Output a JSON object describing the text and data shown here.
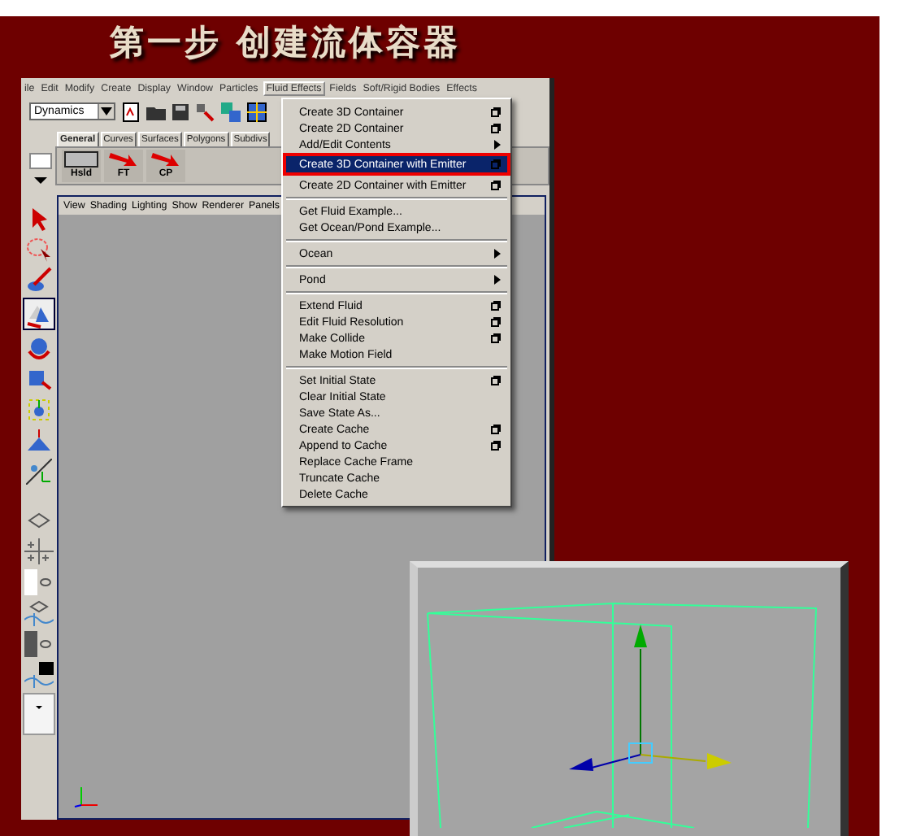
{
  "title": "第一步 创建流体容器",
  "menu_bar": [
    {
      "label": "ile",
      "selected": false
    },
    {
      "label": "Edit",
      "selected": false
    },
    {
      "label": "Modify",
      "selected": false
    },
    {
      "label": "Create",
      "selected": false
    },
    {
      "label": "Display",
      "selected": false
    },
    {
      "label": "Window",
      "selected": false
    },
    {
      "label": "Particles",
      "selected": false
    },
    {
      "label": "Fluid Effects",
      "selected": true
    },
    {
      "label": "Fields",
      "selected": false
    },
    {
      "label": "Soft/Rigid Bodies",
      "selected": false
    },
    {
      "label": "Effects",
      "selected": false
    }
  ],
  "mode_dropdown": {
    "value": "Dynamics"
  },
  "shelf_tabs": [
    {
      "label": "General",
      "selected": true
    },
    {
      "label": "Curves",
      "selected": false
    },
    {
      "label": "Surfaces",
      "selected": false
    },
    {
      "label": "Polygons",
      "selected": false
    },
    {
      "label": "Subdivs",
      "selected": false
    }
  ],
  "shelf_items": [
    {
      "label": "Hsld",
      "kind": "box"
    },
    {
      "label": "FT",
      "kind": "arrow"
    },
    {
      "label": "CP",
      "kind": "arrow"
    }
  ],
  "panel_menu": [
    "View",
    "Shading",
    "Lighting",
    "Show",
    "Renderer",
    "Panels"
  ],
  "fluid_menu": [
    {
      "kind": "item",
      "label": "Create 3D Container",
      "option_box": true,
      "selected": false
    },
    {
      "kind": "item",
      "label": "Create 2D Container",
      "option_box": true,
      "selected": false
    },
    {
      "kind": "submenu",
      "label": "Add/Edit Contents",
      "selected": false
    },
    {
      "kind": "item",
      "label": "Create 3D Container with Emitter",
      "option_box": true,
      "selected": true,
      "annotated": true
    },
    {
      "kind": "item",
      "label": "Create 2D Container with Emitter",
      "option_box": true,
      "selected": false
    },
    {
      "kind": "separator"
    },
    {
      "kind": "item",
      "label": "Get Fluid Example...",
      "option_box": false,
      "selected": false
    },
    {
      "kind": "item",
      "label": "Get Ocean/Pond Example...",
      "option_box": false,
      "selected": false
    },
    {
      "kind": "separator"
    },
    {
      "kind": "submenu",
      "label": "Ocean",
      "selected": false
    },
    {
      "kind": "separator"
    },
    {
      "kind": "submenu",
      "label": "Pond",
      "selected": false
    },
    {
      "kind": "separator"
    },
    {
      "kind": "item",
      "label": "Extend Fluid",
      "option_box": true,
      "selected": false
    },
    {
      "kind": "item",
      "label": "Edit Fluid Resolution",
      "option_box": true,
      "selected": false
    },
    {
      "kind": "item",
      "label": "Make Collide",
      "option_box": true,
      "selected": false
    },
    {
      "kind": "item",
      "label": "Make Motion Field",
      "option_box": false,
      "selected": false
    },
    {
      "kind": "separator"
    },
    {
      "kind": "item",
      "label": "Set Initial State",
      "option_box": true,
      "selected": false
    },
    {
      "kind": "item",
      "label": "Clear Initial State",
      "option_box": false,
      "selected": false
    },
    {
      "kind": "item",
      "label": "Save State As...",
      "option_box": false,
      "selected": false
    },
    {
      "kind": "item",
      "label": "Create Cache",
      "option_box": true,
      "selected": false
    },
    {
      "kind": "item",
      "label": "Append to Cache",
      "option_box": true,
      "selected": false
    },
    {
      "kind": "item",
      "label": "Replace Cache Frame",
      "option_box": false,
      "selected": false
    },
    {
      "kind": "item",
      "label": "Truncate Cache",
      "option_box": false,
      "selected": false
    },
    {
      "kind": "item",
      "label": "Delete Cache",
      "option_box": false,
      "selected": false
    }
  ]
}
